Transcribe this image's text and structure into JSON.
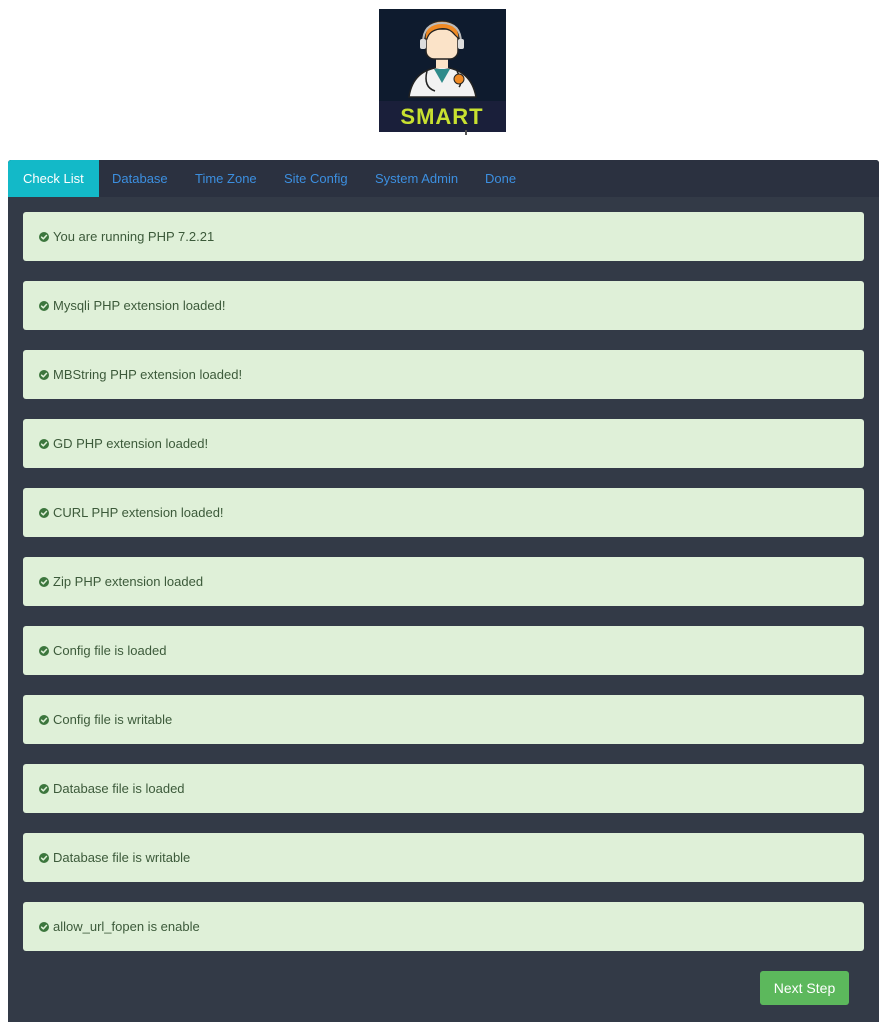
{
  "logo": {
    "wordmark": "SMART"
  },
  "tabs": [
    {
      "label": "Check List",
      "active": true
    },
    {
      "label": "Database",
      "active": false
    },
    {
      "label": "Time Zone",
      "active": false
    },
    {
      "label": "Site Config",
      "active": false
    },
    {
      "label": "System Admin",
      "active": false
    },
    {
      "label": "Done",
      "active": false
    }
  ],
  "checks": [
    {
      "text": "You are running PHP 7.2.21",
      "icon": "check-circle-icon"
    },
    {
      "text": "Mysqli PHP extension loaded!",
      "icon": "check-circle-icon"
    },
    {
      "text": "MBString PHP extension loaded!",
      "icon": "check-circle-icon"
    },
    {
      "text": "GD PHP extension loaded!",
      "icon": "check-circle-icon"
    },
    {
      "text": "CURL PHP extension loaded!",
      "icon": "check-circle-icon"
    },
    {
      "text": "Zip PHP extension loaded",
      "icon": "check-circle-icon"
    },
    {
      "text": "Config file is loaded",
      "icon": "check-circle-icon"
    },
    {
      "text": "Config file is writable",
      "icon": "check-circle-icon"
    },
    {
      "text": "Database file is loaded",
      "icon": "check-circle-icon"
    },
    {
      "text": "Database file is writable",
      "icon": "check-circle-icon"
    },
    {
      "text": "allow_url_fopen is enable",
      "icon": "check-circle-icon"
    }
  ],
  "actions": {
    "next_label": "Next Step"
  },
  "colors": {
    "panel_bg": "#333a47",
    "active_tab": "#13b9c8",
    "tab_link": "#3c8fe0",
    "success_bg": "#dff0d8",
    "success_icon": "#3c763d",
    "button_green": "#5cb85c"
  }
}
